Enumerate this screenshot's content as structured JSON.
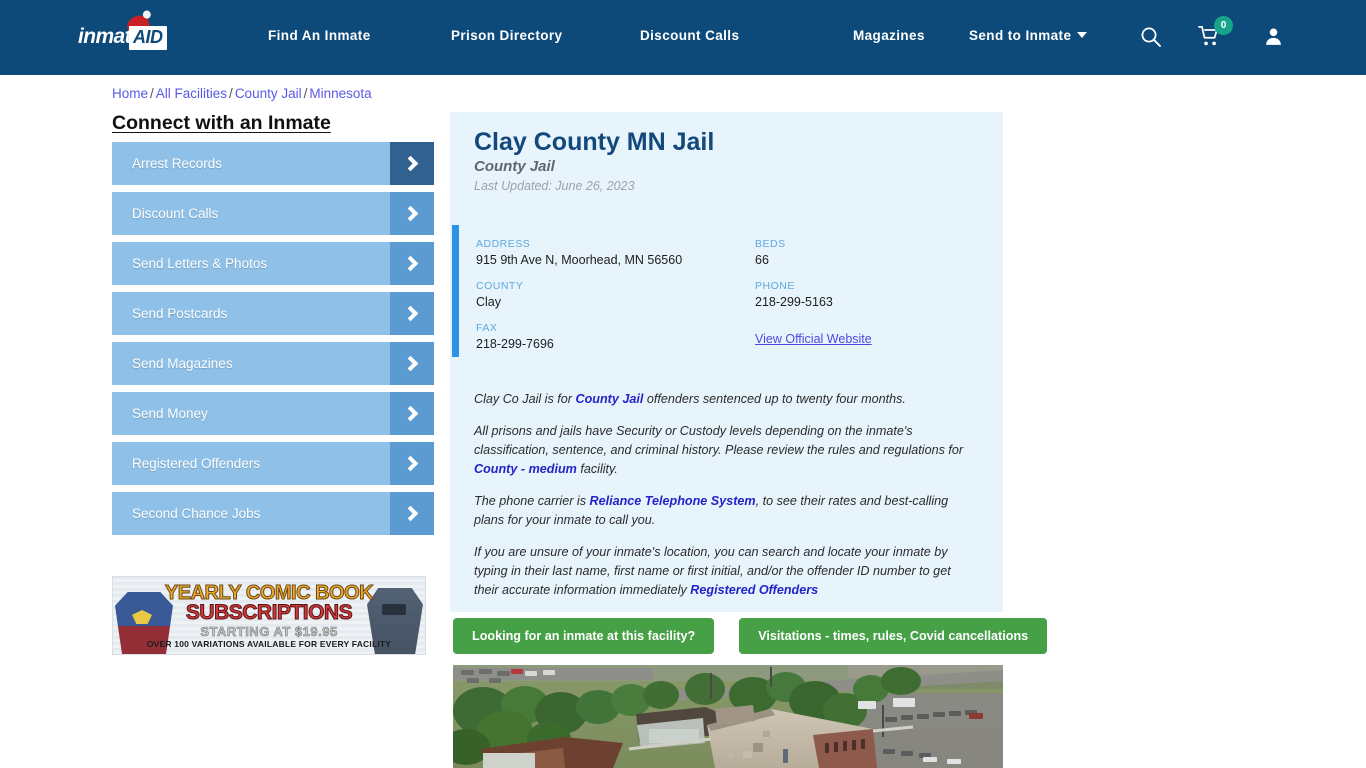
{
  "header": {
    "logo": {
      "word1": "inmate",
      "word2": "AID",
      "hat_icon": "santa-hat-icon"
    },
    "nav": [
      {
        "label": "Find An Inmate",
        "has_caret": false
      },
      {
        "label": "Prison Directory",
        "has_caret": false
      },
      {
        "label": "Discount Calls",
        "has_caret": false
      },
      {
        "label": "Magazines",
        "has_caret": false
      },
      {
        "label": "Send to Inmate",
        "has_caret": true
      }
    ],
    "icons": {
      "search": "search-icon",
      "cart": "shopping-cart-icon",
      "cart_count": "0",
      "user": "user-account-icon"
    },
    "background_color": "#0d4a7a"
  },
  "breadcrumb": {
    "items": [
      "Home",
      "All Facilities",
      "County Jail",
      "Minnesota"
    ],
    "separator": "/"
  },
  "sidebar": {
    "title": "Connect with an Inmate",
    "items": [
      {
        "label": "Arrest Records",
        "active": true
      },
      {
        "label": "Discount Calls",
        "active": false
      },
      {
        "label": "Send Letters & Photos",
        "active": false
      },
      {
        "label": "Send Postcards",
        "active": false
      },
      {
        "label": "Send Magazines",
        "active": false
      },
      {
        "label": "Send Money",
        "active": false
      },
      {
        "label": "Registered Offenders",
        "active": false
      },
      {
        "label": "Second Chance Jobs",
        "active": false
      }
    ]
  },
  "ad": {
    "line1": "YEARLY COMIC BOOK",
    "line2": "SUBSCRIPTIONS",
    "line3": "STARTING AT $19.95",
    "line4": "OVER 100 VARIATIONS AVAILABLE FOR EVERY FACILITY"
  },
  "facility": {
    "name": "Clay County MN Jail",
    "type": "County Jail",
    "last_updated": "Last Updated: June 26, 2023",
    "info": {
      "address_label": "ADDRESS",
      "address_value": "915 9th Ave N, Moorhead, MN 56560",
      "county_label": "COUNTY",
      "county_value": "Clay",
      "fax_label": "FAX",
      "fax_value": "218-299-7696",
      "beds_label": "BEDS",
      "beds_value": "66",
      "phone_label": "PHONE",
      "phone_value": "218-299-5163",
      "website_link": "View Official Website"
    },
    "paragraphs": {
      "p1_a": "Clay Co Jail is for ",
      "p1_link": "County Jail",
      "p1_b": " offenders sentenced up to twenty four months.",
      "p2_a": "All prisons and jails have Security or Custody levels depending on the inmate's classification, sentence, and criminal history. Please review the rules and regulations for ",
      "p2_link": "County - medium",
      "p2_b": " facility.",
      "p3_a": "The phone carrier is ",
      "p3_link": "Reliance Telephone System",
      "p3_b": ", to see their rates and best-calling plans for your inmate to call you.",
      "p4_a": "If you are unsure of your inmate's location, you can search and locate your inmate by typing in their last name, first name or first initial, and/or the offender ID number to get their accurate information immediately ",
      "p4_link": "Registered Offenders"
    }
  },
  "cta": {
    "primary": "Looking for an inmate at this facility?",
    "secondary": "Visitations - times, rules, Covid cancellations",
    "color": "#46a046"
  },
  "photo": {
    "alt": "aerial-view-of-clay-county-jail"
  },
  "colors": {
    "header_navy": "#0d4a7a",
    "card_blue": "#e7f4fc",
    "accent_blue": "#2d93e8",
    "sidebar_blue": "#8fc1e8",
    "sidebar_arrow": "#5b9bd1",
    "sidebar_arrow_active": "#31618f",
    "green": "#46a046",
    "link_purple": "#5a5ae6",
    "title_navy": "#13487d",
    "badge_teal": "#17a589"
  }
}
